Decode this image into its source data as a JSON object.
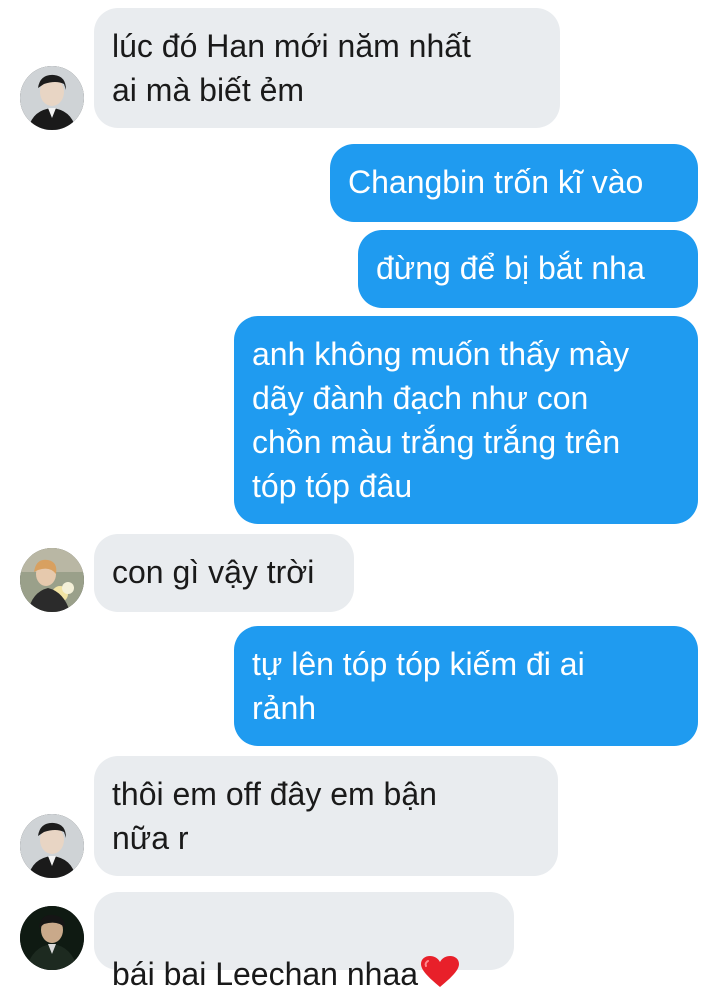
{
  "colors": {
    "incoming_bubble": "#e9ecef",
    "outgoing_bubble": "#1f9bf0",
    "heart": "#e8202a"
  },
  "messages": [
    {
      "side": "incoming",
      "text": "lúc đó Han mới năm nhất\nai mà biết ẻm",
      "avatar": "avatar-dark-suit"
    },
    {
      "side": "outgoing",
      "text": "Changbin trốn kĩ vào"
    },
    {
      "side": "outgoing",
      "text": "đừng để bị bắt nha"
    },
    {
      "side": "outgoing",
      "text": "anh không muốn thấy mày\ndãy đành đạch như con\nchồn màu trắng trắng trên\ntóp tóp đâu"
    },
    {
      "side": "incoming",
      "text": "con gì vậy trời",
      "avatar": "avatar-flowers"
    },
    {
      "side": "outgoing",
      "text": "tự lên tóp tóp kiếm đi ai\nrảnh"
    },
    {
      "side": "incoming",
      "text": "thôi em off đây em bận\nnữa r",
      "avatar": "avatar-dark-suit"
    },
    {
      "side": "incoming",
      "text": "bái bai Leechan nhaa",
      "emoji": "heart-emoji",
      "avatar": "avatar-dark-portrait"
    }
  ]
}
